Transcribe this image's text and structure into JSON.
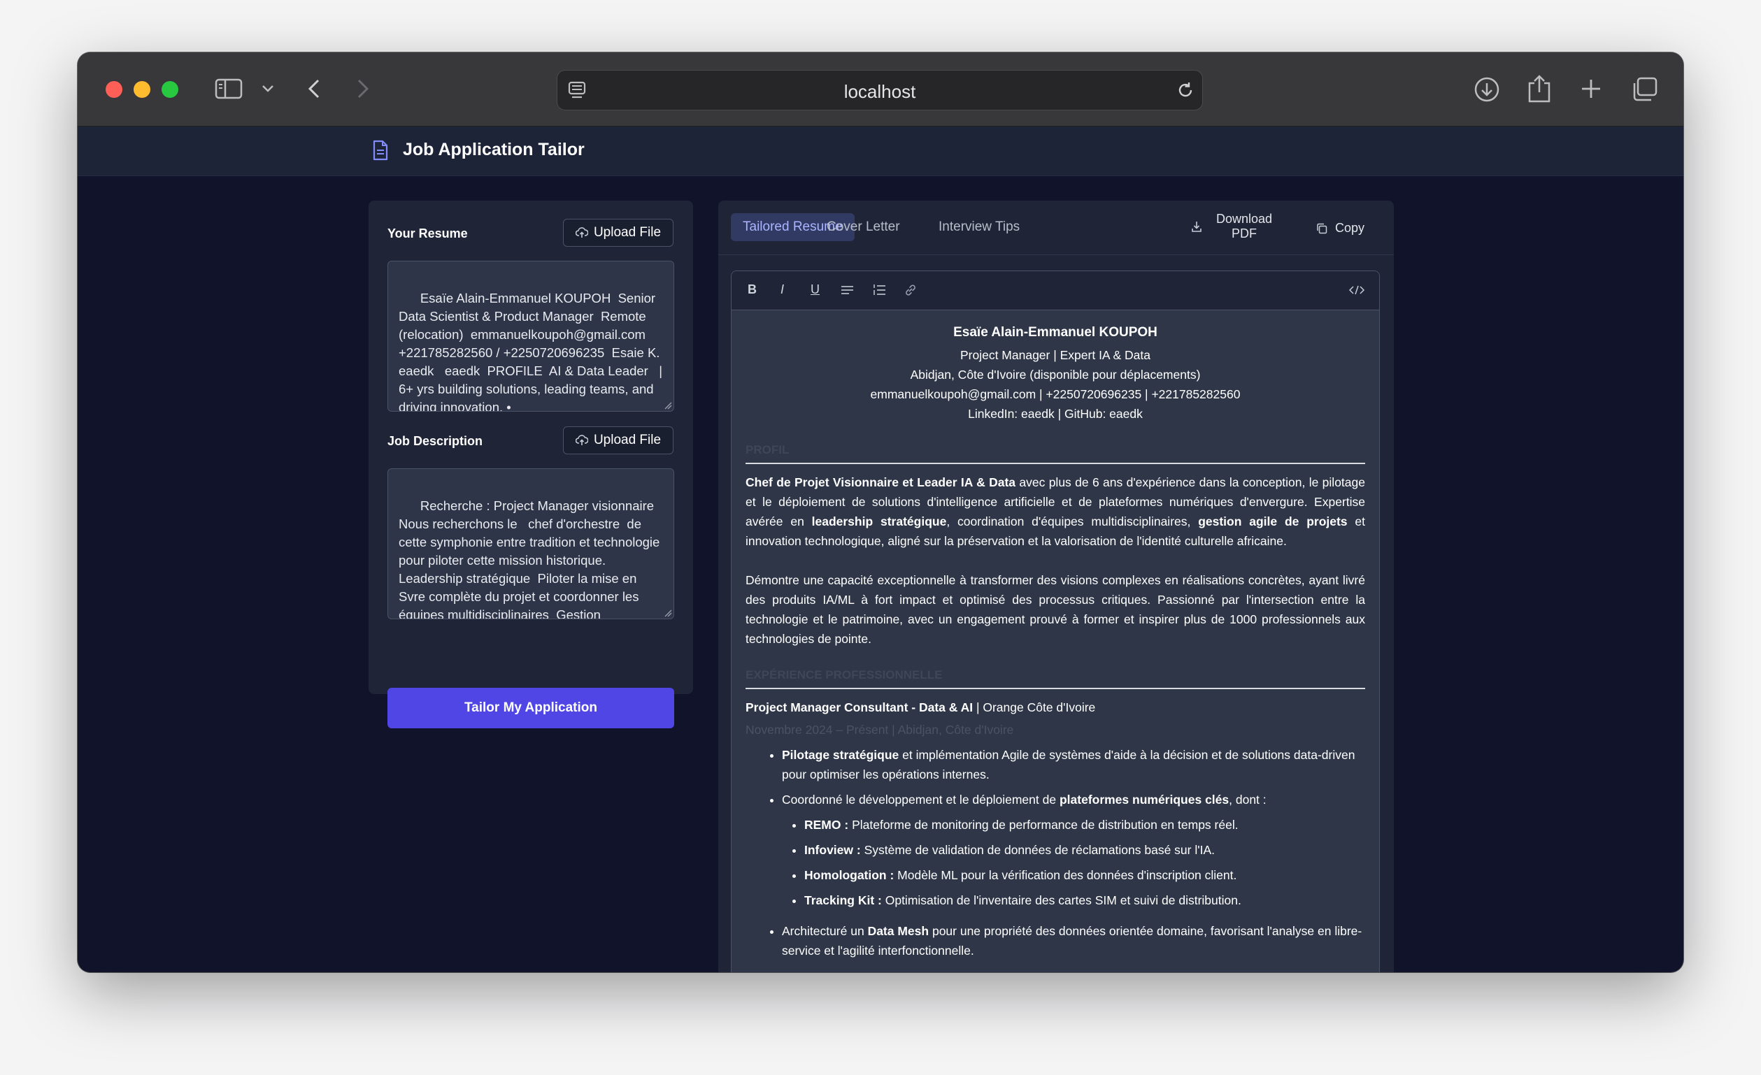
{
  "browser": {
    "url": "localhost"
  },
  "app": {
    "title": "Job Application Tailor"
  },
  "resume": {
    "label": "Your Resume",
    "upload_label": "Upload File",
    "text": "Esaïe Alain-Emmanuel KOUPOH  Senior Data Scientist & Product Manager  Remote (relocation)  emmanuelkoupoh@gmail.com  +221785282560 / +2250720696235  Esaie K.   eaedk   eaedk  PROFILE  AI & Data Leader   | 6+ yrs building solutions, leading teams, and driving innovation. •"
  },
  "job": {
    "label": "Job Description",
    "upload_label": "Upload File",
    "text": "Recherche : Project Manager visionnaire  Nous recherchons le   chef d'orchestre  de cette symphonie entre tradition et technologie pour piloter cette mission historique.  Leadership stratégique  Piloter la mise en Svre complète du projet et coordonner les équipes multidisciplinaires  Gestion budgétaire  Superviser un budget"
  },
  "submit_label": "Tailor My Application",
  "tabs": [
    {
      "label": "Tailored Resume",
      "active": true
    },
    {
      "label": "Cover Letter",
      "active": false
    },
    {
      "label": "Interview Tips",
      "active": false
    }
  ],
  "actions": {
    "download_line1": "Download",
    "download_line2": "PDF",
    "copy": "Copy"
  },
  "editor_toolbar": [
    "B",
    "I",
    "U"
  ],
  "doc": {
    "name": "Esaïe Alain-Emmanuel KOUPOH",
    "headline": "Project Manager | Expert IA & Data",
    "location": "Abidjan, Côte d'Ivoire (disponible pour déplacements)",
    "contact": "emmanuelkoupoh@gmail.com | +2250720696235 | +221785282560",
    "links": "LinkedIn: eaedk | GitHub: eaedk",
    "profile_title": "PROFIL",
    "profile_p1_b1": "Chef de Projet Visionnaire et Leader IA & Data",
    "profile_p1_t1": " avec plus de 6 ans d'expérience dans la conception, le pilotage et le déploiement de solutions d'intelligence artificielle et de plateformes numériques d'envergure. Expertise avérée en ",
    "profile_p1_b2": "leadership stratégique",
    "profile_p1_t2": ", coordination d'équipes multidisciplinaires, ",
    "profile_p1_b3": "gestion agile de projets",
    "profile_p1_t3": " et innovation technologique, aligné sur la préservation et la valorisation de l'identité culturelle africaine.",
    "profile_p2": "Démontre une capacité exceptionnelle à transformer des visions complexes en réalisations concrètes, ayant livré des produits IA/ML à fort impact et optimisé des processus critiques. Passionné par l'intersection entre la technologie et le patrimoine, avec un engagement prouvé à former et inspirer plus de 1000 professionnels aux technologies de pointe.",
    "experience_title": "EXPÉRIENCE PROFESSIONNELLE",
    "job_title": "Project Manager Consultant - Data & AI",
    "job_company": " | Orange Côte d'Ivoire",
    "job_dates": "Novembre 2024 – Présent | Abidjan, Côte d'Ivoire",
    "bullet1_b": "Pilotage stratégique",
    "bullet1_t": " et implémentation Agile de systèmes d'aide à la décision et de solutions data-driven pour optimiser les opérations internes.",
    "bullet2_t": "Coordonné le développement et le déploiement de ",
    "bullet2_b": "plateformes numériques clés",
    "bullet2_t2": ", dont :",
    "sub": [
      {
        "b": "REMO :",
        "t": " Plateforme de monitoring de performance de distribution en temps réel."
      },
      {
        "b": "Infoview :",
        "t": " Système de validation de données de réclamations basé sur l'IA."
      },
      {
        "b": "Homologation :",
        "t": " Modèle ML pour la vérification des données d'inscription client."
      },
      {
        "b": "Tracking Kit :",
        "t": " Optimisation de l'inventaire des cartes SIM et suivi de distribution."
      }
    ],
    "bullet3_t": "Architecturé un ",
    "bullet3_b": "Data Mesh",
    "bullet3_t2": " pour une propriété des données orientée domaine, favorisant l'analyse en libre-service et l'agilité interfonctionnelle."
  }
}
